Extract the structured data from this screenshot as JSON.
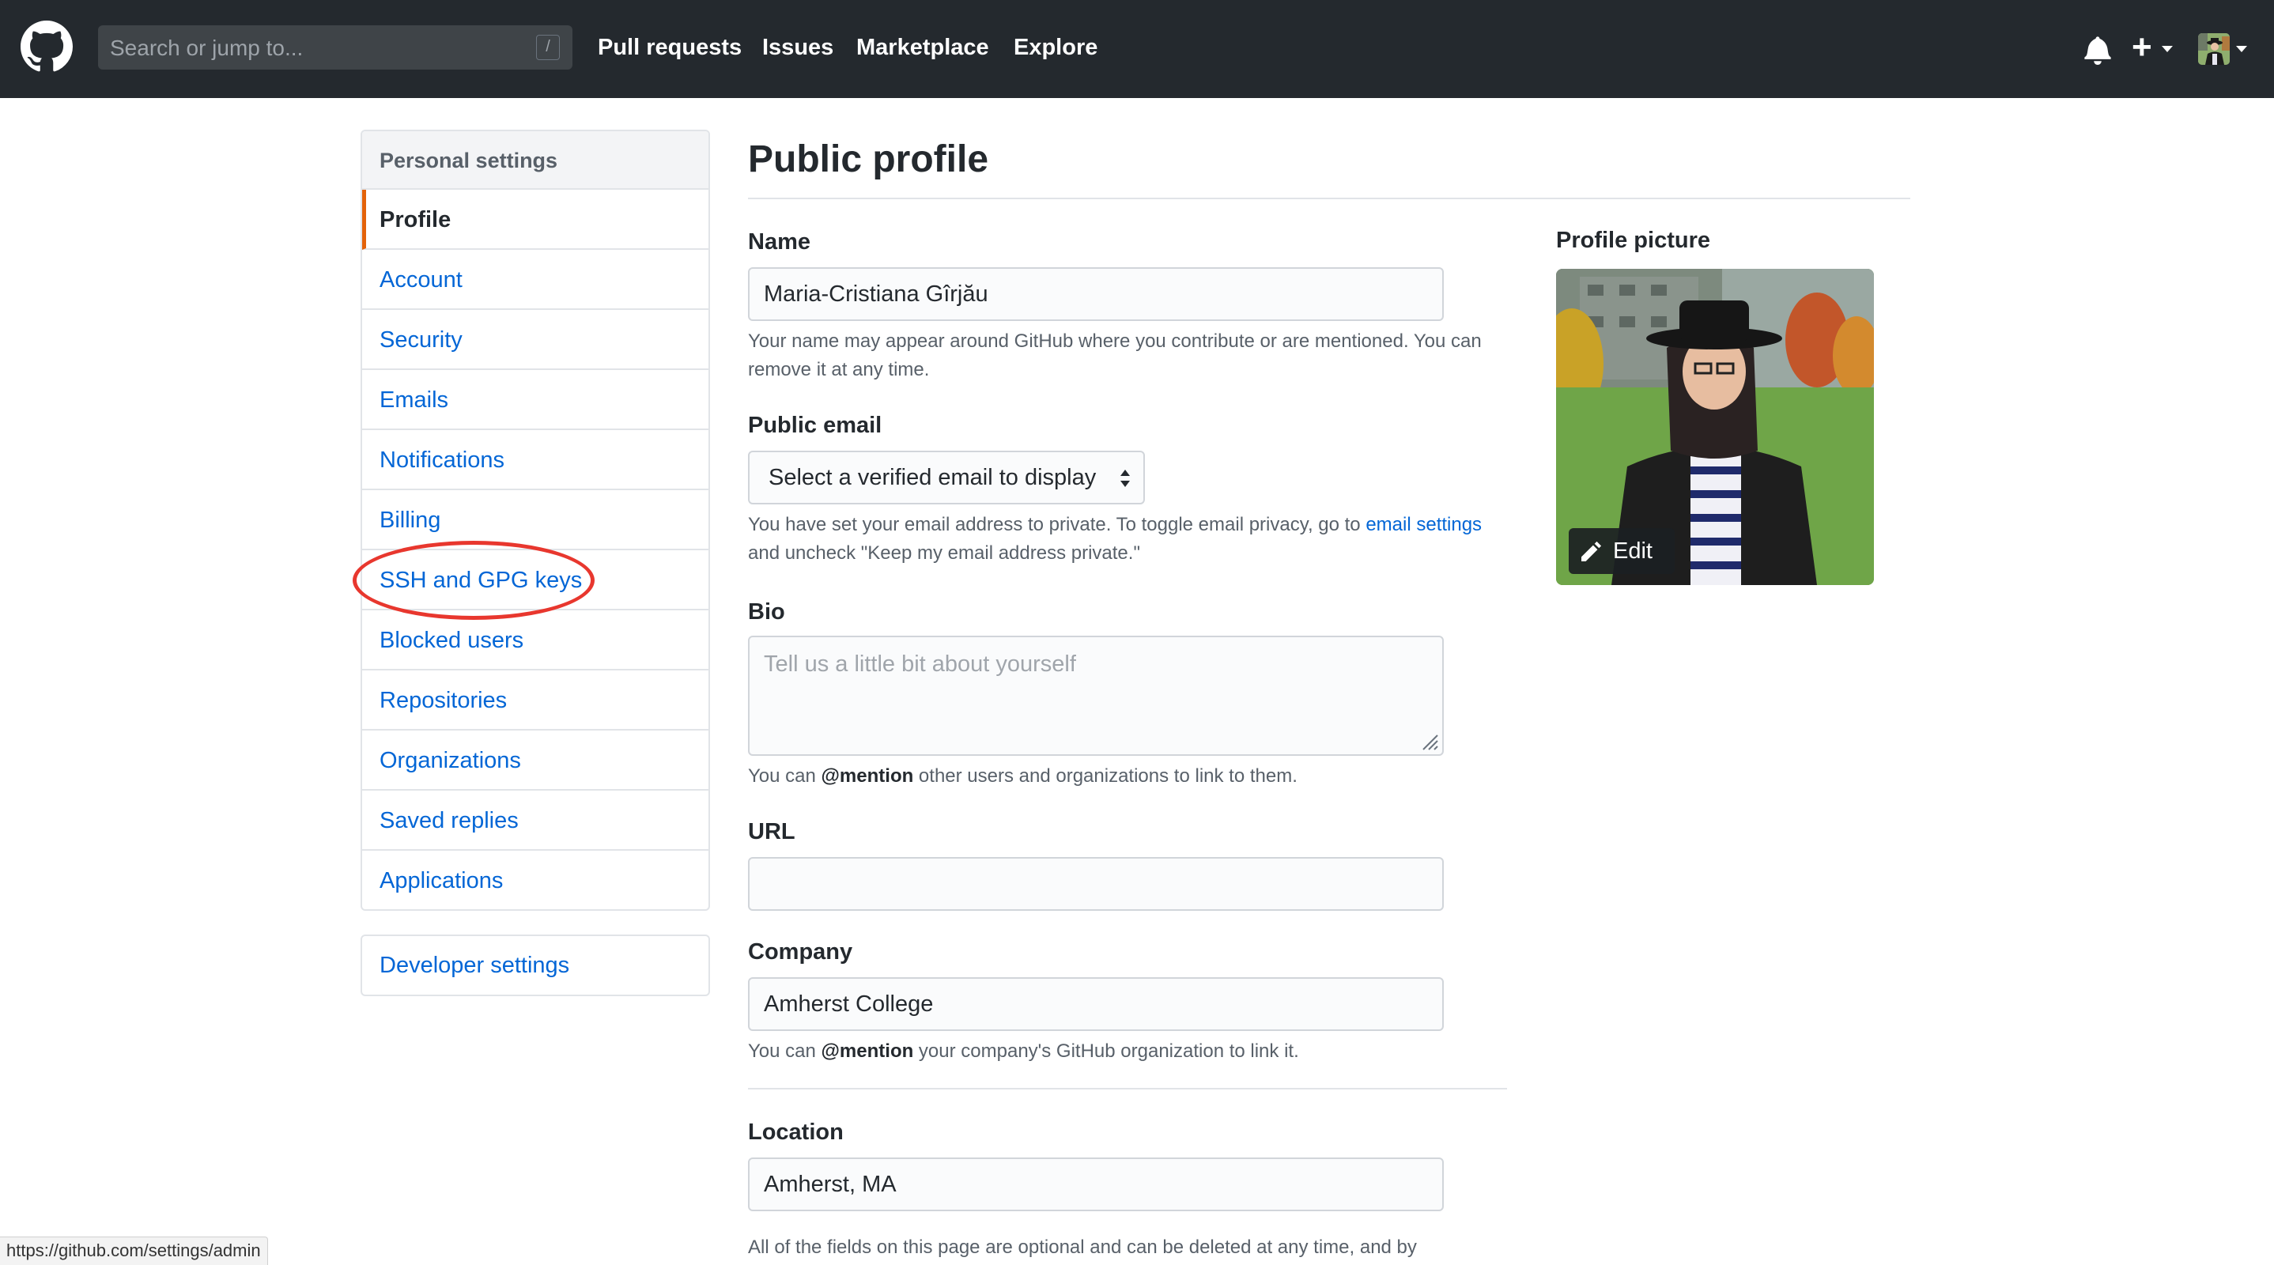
{
  "header": {
    "search_placeholder": "Search or jump to...",
    "search_shortcut": "/",
    "nav": [
      "Pull requests",
      "Issues",
      "Marketplace",
      "Explore"
    ]
  },
  "sidebar": {
    "heading": "Personal settings",
    "items": [
      {
        "label": "Profile",
        "selected": true
      },
      {
        "label": "Account"
      },
      {
        "label": "Security"
      },
      {
        "label": "Emails"
      },
      {
        "label": "Notifications"
      },
      {
        "label": "Billing"
      },
      {
        "label": "SSH and GPG keys",
        "highlighted": true
      },
      {
        "label": "Blocked users"
      },
      {
        "label": "Repositories"
      },
      {
        "label": "Organizations"
      },
      {
        "label": "Saved replies"
      },
      {
        "label": "Applications"
      }
    ],
    "developer": "Developer settings"
  },
  "main": {
    "title": "Public profile",
    "name_label": "Name",
    "name_value": "Maria-Cristiana Gîrjău",
    "name_note": "Your name may appear around GitHub where you contribute or are mentioned. You can remove it at any time.",
    "email_label": "Public email",
    "email_select": "Select a verified email to display",
    "email_note_1": "You have set your email address to private. To toggle email privacy, go to ",
    "email_note_link": "email settings",
    "email_note_2": " and uncheck \"Keep my email address private.\"",
    "bio_label": "Bio",
    "bio_placeholder": "Tell us a little bit about yourself",
    "bio_note_1": "You can ",
    "bio_note_mention": "@mention",
    "bio_note_2": " other users and organizations to link to them.",
    "url_label": "URL",
    "url_value": "",
    "company_label": "Company",
    "company_value": "Amherst College",
    "company_note_1": "You can ",
    "company_note_mention": "@mention",
    "company_note_2": " your company's GitHub organization to link it.",
    "location_label": "Location",
    "location_value": "Amherst, MA",
    "footer_note": "All of the fields on this page are optional and can be deleted at any time, and by"
  },
  "profile_picture": {
    "label": "Profile picture",
    "edit": "Edit"
  },
  "status_bar": "https://github.com/settings/admin",
  "colors": {
    "header_bg": "#24292e",
    "link": "#0366d6",
    "selected_marker": "#e36209",
    "highlight_ring": "#e8372e"
  }
}
